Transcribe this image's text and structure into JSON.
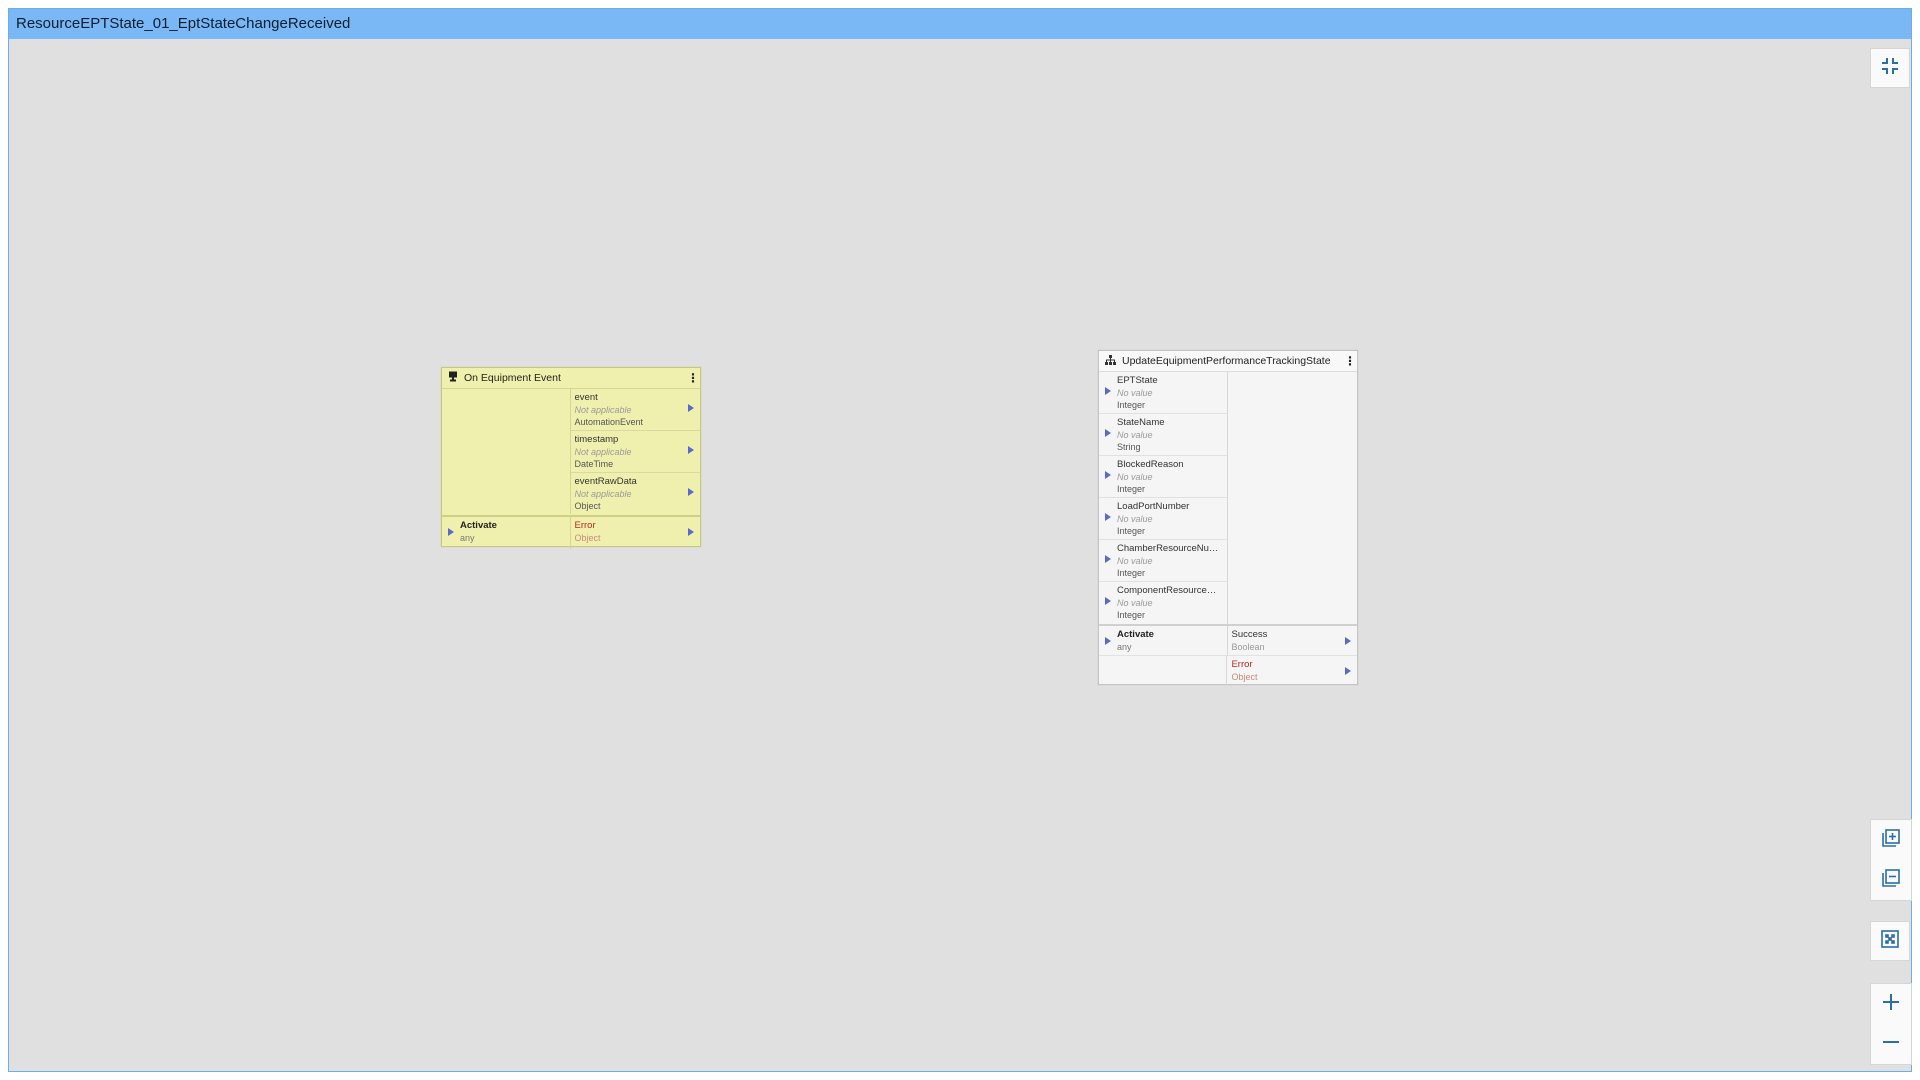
{
  "window": {
    "title": "ResourceEPTState_01_EptStateChangeReceived"
  },
  "event_node": {
    "title": "On Equipment Event",
    "icon": "event-icon",
    "outputs": [
      {
        "name": "event",
        "value": "Not applicable",
        "type": "AutomationEvent"
      },
      {
        "name": "timestamp",
        "value": "Not applicable",
        "type": "DateTime"
      },
      {
        "name": "eventRawData",
        "value": "Not applicable",
        "type": "Object"
      }
    ],
    "activate": {
      "name": "Activate",
      "type": "any"
    },
    "error": {
      "name": "Error",
      "type": "Object"
    }
  },
  "task_node": {
    "title": "UpdateEquipmentPerformanceTrackingState",
    "icon": "hierarchy-icon",
    "inputs": [
      {
        "name": "EPTState",
        "value": "No value",
        "type": "Integer"
      },
      {
        "name": "StateName",
        "value": "No value",
        "type": "String"
      },
      {
        "name": "BlockedReason",
        "value": "No value",
        "type": "Integer"
      },
      {
        "name": "LoadPortNumber",
        "value": "No value",
        "type": "Integer"
      },
      {
        "name": "ChamberResourceNumber",
        "value": "No value",
        "type": "Integer"
      },
      {
        "name": "ComponentResourceNu...",
        "value": "No value",
        "type": "Integer"
      }
    ],
    "activate": {
      "name": "Activate",
      "type": "any"
    },
    "success": {
      "name": "Success",
      "type": "Boolean"
    },
    "error": {
      "name": "Error",
      "type": "Object"
    }
  },
  "toolbar": {
    "collapse_icon": "collapse-icon",
    "expand_all_icon": "expand-all-icon",
    "collapse_all_icon": "collapse-all-icon",
    "fit_icon": "fit-to-screen-icon",
    "zoom_in_icon": "zoom-in-icon",
    "zoom_out_icon": "zoom-out-icon"
  },
  "colors": {
    "titlebar": "#7ab8f5",
    "canvas": "#e0e0e0",
    "event_node": "#f0f0ae",
    "task_node": "#f5f5f5",
    "error": "#b52b1e",
    "port_arrow": "#5a6ac8",
    "tool_icon": "#2a6fa8"
  }
}
